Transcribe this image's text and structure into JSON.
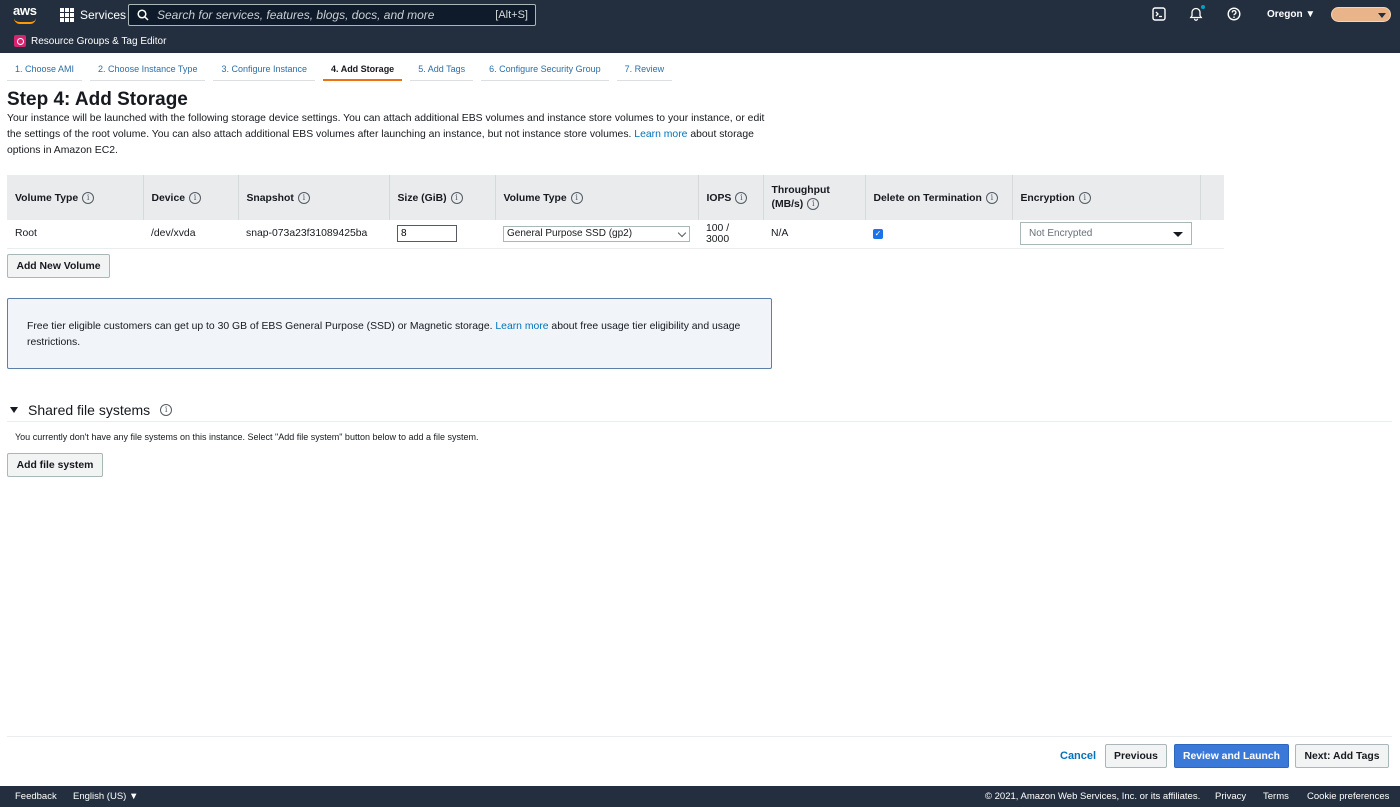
{
  "topnav": {
    "logo_text": "aws",
    "services_label": "Services",
    "search_placeholder": "Search for services, features, blogs, docs, and more",
    "search_shortcut": "[Alt+S]",
    "region_label": "Oregon ▼"
  },
  "subnav": {
    "resource_groups_label": "Resource Groups & Tag Editor"
  },
  "tabs": [
    {
      "label": "1. Choose AMI"
    },
    {
      "label": "2. Choose Instance Type"
    },
    {
      "label": "3. Configure Instance"
    },
    {
      "label": "4. Add Storage",
      "active": true
    },
    {
      "label": "5. Add Tags"
    },
    {
      "label": "6. Configure Security Group"
    },
    {
      "label": "7. Review"
    }
  ],
  "page": {
    "title": "Step 4: Add Storage",
    "intro_text": "Your instance will be launched with the following storage device settings. You can attach additional EBS volumes and instance store volumes to your instance, or edit the settings of the root volume. You can also attach additional EBS volumes after launching an instance, but not instance store volumes.",
    "intro_link": "Learn more",
    "intro_tail": "about storage options in Amazon EC2."
  },
  "table": {
    "headers": {
      "volume_type": "Volume Type",
      "device": "Device",
      "snapshot": "Snapshot",
      "size": "Size (GiB)",
      "volume_type2": "Volume Type",
      "iops": "IOPS",
      "throughput_l1": "Throughput",
      "throughput_l2": "(MB/s)",
      "delete_on_termination": "Delete on Termination",
      "encryption": "Encryption"
    },
    "row": {
      "volume_type": "Root",
      "device": "/dev/xvda",
      "snapshot": "snap-073a23f31089425ba",
      "size": "8",
      "volume_type2": "General Purpose SSD (gp2)",
      "iops": "100 / 3000",
      "throughput": "N/A",
      "delete_on_termination": true,
      "encryption": "Not Encrypted"
    },
    "add_volume_label": "Add New Volume"
  },
  "info_box": {
    "text": "Free tier eligible customers can get up to 30 GB of EBS General Purpose (SSD) or Magnetic storage.",
    "link": "Learn more",
    "tail": "about free usage tier eligibility and usage restrictions."
  },
  "shared_fs": {
    "title": "Shared file systems",
    "description": "You currently don't have any file systems on this instance. Select \"Add file system\" button below to add a file system.",
    "add_label": "Add file system"
  },
  "actions": {
    "cancel": "Cancel",
    "previous": "Previous",
    "review_launch": "Review and Launch",
    "next": "Next: Add Tags"
  },
  "footer": {
    "feedback": "Feedback",
    "language": "English (US) ▼",
    "copyright": "© 2021, Amazon Web Services, Inc. or its affiliates.",
    "privacy": "Privacy",
    "terms": "Terms",
    "cookie": "Cookie preferences"
  },
  "colors": {
    "nav_bg": "#232f3e",
    "accent_orange": "#ec7211",
    "primary_button": "#3b79d8",
    "link_blue": "#0073bb"
  }
}
